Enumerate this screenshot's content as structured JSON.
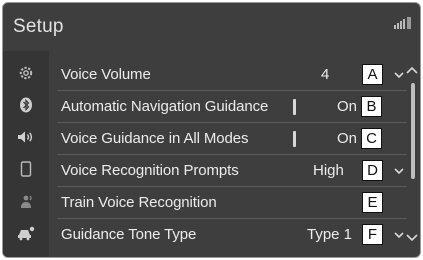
{
  "header": {
    "title": "Setup"
  },
  "sidebar": {
    "icons": [
      "gear-icon",
      "bluetooth-icon",
      "speaker-icon",
      "phone-icon",
      "voice-icon",
      "car-icon"
    ]
  },
  "settings": [
    {
      "label": "Voice Volume",
      "value": "4",
      "callout": "A",
      "has_toggle": false,
      "has_chevron": true
    },
    {
      "label": "Automatic Navigation Guidance",
      "value": "On",
      "callout": "B",
      "has_toggle": true,
      "has_chevron": false
    },
    {
      "label": "Voice Guidance in All Modes",
      "value": "On",
      "callout": "C",
      "has_toggle": true,
      "has_chevron": false
    },
    {
      "label": "Voice Recognition Prompts",
      "value": "High",
      "callout": "D",
      "has_toggle": false,
      "has_chevron": true
    },
    {
      "label": "Train Voice Recognition",
      "value": "",
      "callout": "E",
      "has_toggle": false,
      "has_chevron": false
    },
    {
      "label": "Guidance Tone Type",
      "value": "Type 1",
      "callout": "F",
      "has_toggle": false,
      "has_chevron": true
    }
  ],
  "colors": {
    "panel_bg": "#3e3e3e",
    "text": "#ececec",
    "divider": "#5c5c5c",
    "callout_bg": "#ffffff"
  }
}
